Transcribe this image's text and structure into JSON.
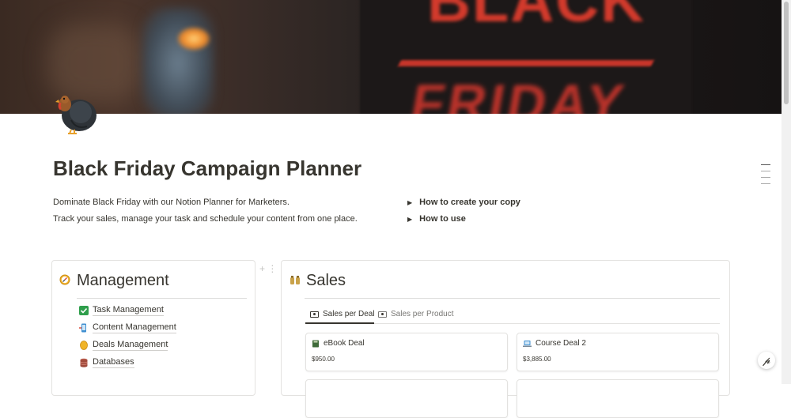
{
  "page": {
    "title": "Black Friday Campaign Planner",
    "icon": "turkey-icon",
    "description_lines": [
      "Dominate Black Friday with our Notion Planner for Marketers.",
      "Track your sales, manage your task and schedule your content from one place."
    ],
    "cover": {
      "text_top": "BLACK",
      "text_bottom": "FRIDAY"
    }
  },
  "toggles": [
    {
      "label": "How to create your copy"
    },
    {
      "label": "How to use"
    }
  ],
  "management": {
    "heading": "Management",
    "icon": "compass-icon",
    "items": [
      {
        "label": "Task Management",
        "icon": "checkbox-icon"
      },
      {
        "label": "Content Management",
        "icon": "phone-icon"
      },
      {
        "label": "Deals Management",
        "icon": "coin-icon"
      },
      {
        "label": "Databases",
        "icon": "database-icon"
      }
    ]
  },
  "sales": {
    "heading": "Sales",
    "icon": "money-bag-icon",
    "tabs": [
      {
        "label": "Sales per Deal",
        "active": true
      },
      {
        "label": "Sales per Product",
        "active": false
      }
    ],
    "cards": [
      {
        "name": "eBook Deal",
        "icon": "book-icon",
        "price": "$950.00"
      },
      {
        "name": "Course Deal 2",
        "icon": "laptop-icon",
        "price": "$3,885.00"
      }
    ]
  },
  "colors": {
    "text": "#37352f",
    "cover_red": "#d23a2c",
    "border": "#e3e2e0"
  }
}
